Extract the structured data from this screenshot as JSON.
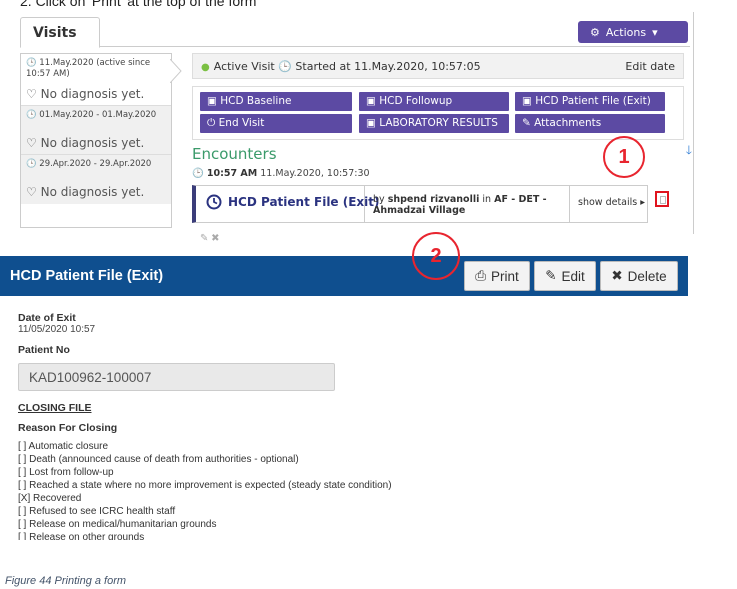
{
  "instruction": "2.   Click on 'Print' at the top of the form",
  "visits_panel": {
    "tab_label": "Visits",
    "actions_label": "Actions",
    "visits": [
      {
        "date": "11.May.2020 (active since 10:57 AM)",
        "diagnosis": "No diagnosis yet."
      },
      {
        "date": "01.May.2020 - 01.May.2020",
        "diagnosis": "No diagnosis yet."
      },
      {
        "date": "29.Apr.2020 - 29.Apr.2020",
        "diagnosis": "No diagnosis yet."
      }
    ]
  },
  "visit_detail": {
    "active_visit": "Active Visit",
    "started_at": "Started at 11.May.2020, 10:57:05",
    "edit_date": "Edit date",
    "forms": [
      "HCD Baseline",
      "HCD Followup",
      "HCD Patient File (Exit)",
      "End Visit",
      "LABORATORY RESULTS",
      "Attachments"
    ],
    "encounters_title": "Encounters",
    "encounter_time": "10:57 AM",
    "encounter_datetime": "11.May.2020, 10:57:30",
    "encounter_form": "HCD Patient File (Exit)",
    "encounter_by_prefix": "by",
    "encounter_user": "shpend rizvanolli",
    "encounter_in": "in",
    "encounter_location": "AF - DET - Ahmadzai Village",
    "show_details": "show details"
  },
  "callouts": {
    "one": "1",
    "two": "2"
  },
  "form_view": {
    "title": "HCD Patient File (Exit)",
    "print_label": "Print",
    "edit_label": "Edit",
    "delete_label": "Delete",
    "date_of_exit_label": "Date of Exit",
    "date_of_exit_value": "11/05/2020 10:57",
    "patient_no_label": "Patient No",
    "patient_no_value": "KAD100962-100007",
    "closing_file": "CLOSING FILE",
    "reason_label": "Reason For Closing",
    "reasons": [
      "[ ] Automatic closure",
      "[ ] Death (announced cause of death from authorities - optional)",
      "[ ] Lost from follow-up",
      "[ ] Reached a state where no more improvement is expected (steady state condition)",
      "[X] Recovered",
      "[ ] Refused to see ICRC health staff",
      "[ ] Release on medical/humanitarian grounds",
      "[ ] Release on other grounds"
    ]
  },
  "caption": "Figure 44 Printing a form",
  "colors": {
    "brand_purple": "#5c4aa3",
    "header_blue": "#0f4f8f",
    "callout_red": "#e8252f",
    "encounters_green": "#3a9a6a"
  }
}
